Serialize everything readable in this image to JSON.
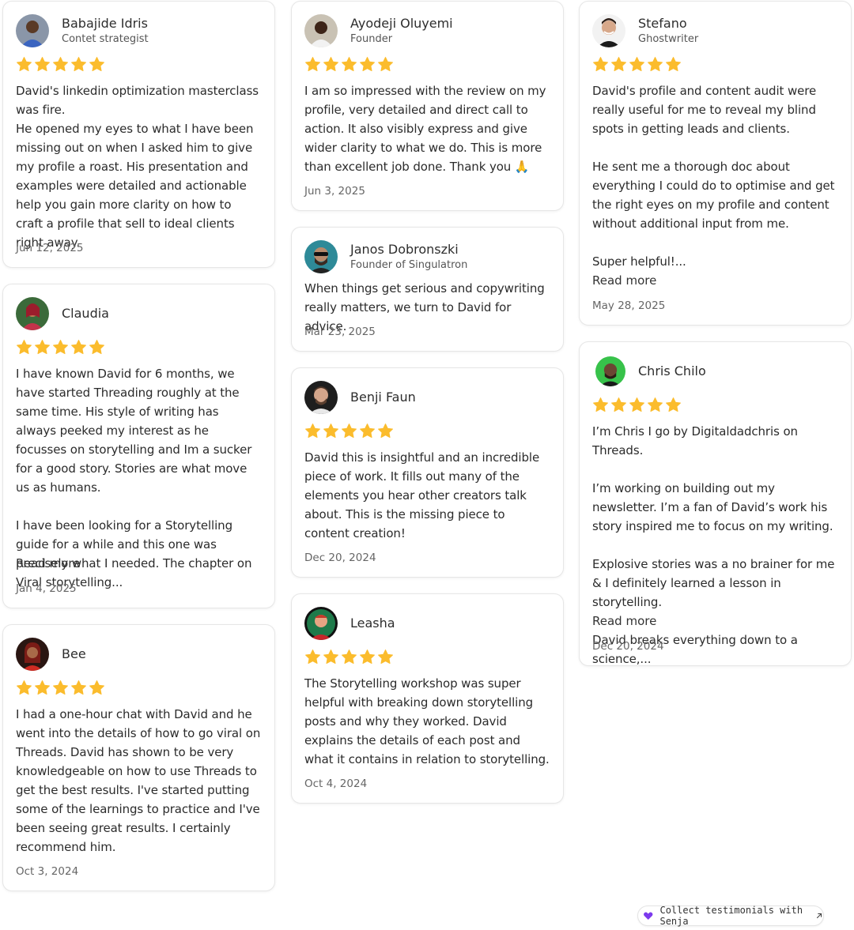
{
  "colors": {
    "star": "#FBBC2D",
    "accent": "#7C3AED"
  },
  "cards": [
    {
      "name": "Babajide Idris",
      "title": "Contet strategist",
      "text": "David's linkedin optimization masterclass was fire.\nHe opened my eyes to what I have been missing out on when I asked him to give my profile a roast. His presentation and examples were detailed and actionable help you gain more clarity on how to craft a profile that sell to ideal clients right away.",
      "date": "Jun 12, 2025"
    },
    {
      "name": "Claudia",
      "text": "I have known David for 6 months, we have started Threading roughly at the same time. His style of writing has always peeked my interest as he focusses on storytelling and Im a sucker for a good story. Stories are what move us as humans.\n\nI have been looking for a Storytelling guide for a while and this one was precisely what I needed. The chapter on Viral storytelling...",
      "read_more": "Read more",
      "date": "Jan 4, 2025"
    },
    {
      "name": "Bee",
      "text": "I had a one-hour chat with David and he went into the details of how to go viral on Threads. David has shown to be very knowledgeable on how to use Threads to get the best results. I've started putting some of the learnings to practice and I've been seeing great results. I certainly recommend him.",
      "date": "Oct 3, 2024"
    },
    {
      "name": "Ayodeji Oluyemi",
      "title": "Founder",
      "text": "I am so impressed with the review on my profile, very detailed and direct call to action. It also visibly express and give wider clarity to what we do. This is more than excellent job done. Thank you 🙏",
      "date": "Jun 3, 2025"
    },
    {
      "name": "Janos Dobronszki",
      "title": "Founder of Singulatron",
      "text": "When things get serious and copywriting really matters, we turn to David for advice.",
      "date": "Mar 23, 2025"
    },
    {
      "name": "Benji Faun",
      "text": "David this is insightful and an incredible piece of work. It fills out many of the elements you hear other creators talk about. This is the missing piece to content creation!",
      "date": "Dec 20, 2024"
    },
    {
      "name": "Leasha",
      "text": "The Storytelling workshop was super helpful with breaking down storytelling posts and why they worked. David explains the details of each post and what it contains in relation to storytelling.",
      "date": "Oct 4, 2024"
    },
    {
      "name": "Stefano",
      "title": "Ghostwriter",
      "text": "David's profile and content audit were really useful for me to reveal my blind spots in getting leads and clients.\n\nHe sent me a thorough doc about everything I could do to optimise and get the right eyes on my profile and content without additional input from me.\n\nSuper helpful!...",
      "read_more": "Read more",
      "date": "May 28, 2025"
    },
    {
      "name": "Chris Chilo",
      "text": "I’m Chris I go by Digitaldadchris on Threads.\n\nI’m working on building out my newsletter. I’m a fan of David’s work his story inspired me to focus on my writing.\n\nExplosive stories was a no brainer for me & I definitely learned a lesson in storytelling.\n\nDavid breaks everything down to a science,...",
      "read_more": "Read more",
      "date": "Dec 20, 2024"
    }
  ],
  "footer": {
    "badge_label": "Collect testimonials with Senja"
  }
}
